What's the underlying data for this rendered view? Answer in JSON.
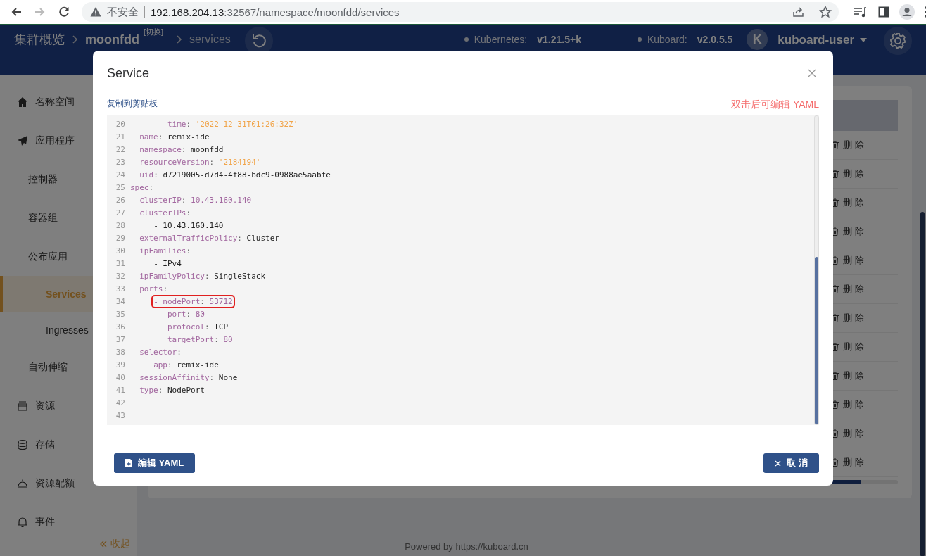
{
  "browser": {
    "nav_buttons": [
      {
        "kind": "back",
        "disabled": false
      },
      {
        "kind": "forward",
        "disabled": true
      },
      {
        "kind": "reload",
        "disabled": false
      }
    ],
    "security_label": "不安全",
    "url_host": "192.168.204.13",
    "url_rest": ":32567/namespace/moonfdd/services"
  },
  "header": {
    "breadcrumbs": [
      {
        "label": "集群概览"
      },
      {
        "label": "moonfdd",
        "switch_label": "[切换]"
      },
      {
        "label": "services"
      }
    ],
    "versions": [
      {
        "name": "Kubernetes:",
        "value": "v1.21.5+k"
      },
      {
        "name": "Kuboard:",
        "value": "v2.0.5.5"
      }
    ],
    "user": {
      "initial": "K",
      "name": "kuboard-user"
    }
  },
  "sidebar": {
    "items": [
      {
        "label": "名称空间",
        "kind": "home",
        "selected": false
      },
      {
        "label": "应用程序",
        "kind": "send",
        "selected": false,
        "children": [
          {
            "label": "控制器",
            "selected": false
          },
          {
            "label": "容器组",
            "selected": false
          },
          {
            "label": "公布应用",
            "selected": false,
            "children": [
              {
                "label": "Services",
                "selected": true
              },
              {
                "label": "Ingresses",
                "selected": false
              }
            ]
          },
          {
            "label": "自动伸缩",
            "selected": false
          }
        ]
      },
      {
        "label": "资源",
        "kind": "box",
        "selected": false
      },
      {
        "label": "存储",
        "kind": "database",
        "selected": false
      },
      {
        "label": "资源配额",
        "kind": "dome",
        "selected": false
      },
      {
        "label": "事件",
        "kind": "bell",
        "selected": false
      }
    ],
    "collapse_label": "收起"
  },
  "table": {
    "rows": [
      {
        "action": "删除"
      },
      {
        "action": "删除"
      },
      {
        "action": "删除"
      },
      {
        "action": "删除"
      },
      {
        "action": "删除"
      },
      {
        "action": "删除"
      },
      {
        "action": "删除"
      },
      {
        "action": "删除"
      },
      {
        "action": "删除"
      },
      {
        "action": "删除"
      },
      {
        "action": "删除"
      },
      {
        "action": "删除"
      }
    ]
  },
  "footer": {
    "text": "Powered by https://kuboard.cn"
  },
  "modal": {
    "title": "Service",
    "copy_link": "复制到剪贴板",
    "hint": "双击后可编辑 YAML",
    "lines": [
      {
        "number": "20",
        "kind": "string",
        "key": "        time:",
        "value": "'2022-12-31T01:26:32Z'",
        "highlighted": false
      },
      {
        "number": "21",
        "kind": "plain",
        "key": "  name:",
        "value": "remix-ide",
        "highlighted": false
      },
      {
        "number": "22",
        "kind": "plain",
        "key": "  namespace:",
        "value": "moonfdd",
        "highlighted": false
      },
      {
        "number": "23",
        "kind": "string",
        "key": "  resourceVersion:",
        "value": "'2184194'",
        "highlighted": false
      },
      {
        "number": "24",
        "kind": "plain",
        "key": "  uid:",
        "value": "d7219005-d7d4-4f88-bdc9-0988ae5aabfe",
        "highlighted": false
      },
      {
        "number": "25",
        "kind": "key",
        "key": "spec:",
        "highlighted": false
      },
      {
        "number": "26",
        "kind": "number",
        "key": "  clusterIP:",
        "value": "10.43.160.140",
        "highlighted": false
      },
      {
        "number": "27",
        "kind": "key",
        "key": "  clusterIPs:",
        "highlighted": false
      },
      {
        "number": "28",
        "kind": "item",
        "item": "     - 10.43.160.140",
        "highlighted": false
      },
      {
        "number": "29",
        "kind": "plain",
        "key": "  externalTrafficPolicy:",
        "value": "Cluster",
        "highlighted": false
      },
      {
        "number": "30",
        "kind": "key",
        "key": "  ipFamilies:",
        "highlighted": false
      },
      {
        "number": "31",
        "kind": "item",
        "item": "     - IPv4",
        "highlighted": false
      },
      {
        "number": "32",
        "kind": "plain",
        "key": "  ipFamilyPolicy:",
        "value": "SingleStack",
        "highlighted": false
      },
      {
        "number": "33",
        "kind": "key",
        "key": "  ports:",
        "highlighted": false
      },
      {
        "number": "34",
        "kind": "number",
        "key": "     - nodePort:",
        "value": "53712",
        "highlighted": true
      },
      {
        "number": "35",
        "kind": "number",
        "key": "        port:",
        "value": "80",
        "highlighted": false
      },
      {
        "number": "36",
        "kind": "plain",
        "key": "        protocol:",
        "value": "TCP",
        "highlighted": false
      },
      {
        "number": "37",
        "kind": "number",
        "key": "        targetPort:",
        "value": "80",
        "highlighted": false
      },
      {
        "number": "38",
        "kind": "key",
        "key": "  selector:",
        "highlighted": false
      },
      {
        "number": "39",
        "kind": "plain",
        "key": "     app:",
        "value": "remix-ide",
        "highlighted": false
      },
      {
        "number": "40",
        "kind": "plain",
        "key": "  sessionAffinity:",
        "value": "None",
        "highlighted": false
      },
      {
        "number": "41",
        "kind": "plain",
        "key": "  type:",
        "value": "NodePort",
        "highlighted": false
      },
      {
        "number": "42",
        "kind": "blank",
        "highlighted": false
      },
      {
        "number": "43",
        "kind": "blank",
        "highlighted": false
      }
    ],
    "buttons": [
      {
        "kind": "edit",
        "label": "编辑 YAML"
      },
      {
        "kind": "cancel",
        "label": "取 消"
      }
    ]
  }
}
